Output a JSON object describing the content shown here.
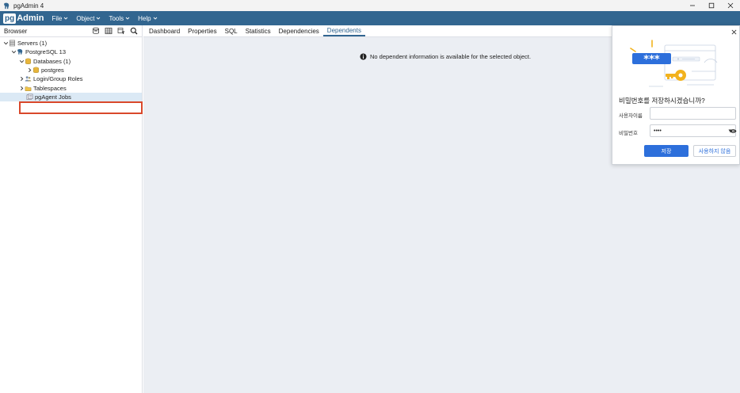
{
  "window": {
    "title": "pgAdmin 4"
  },
  "menubar": {
    "logo_pg": "pg",
    "logo_admin": "Admin",
    "items": [
      {
        "label": "File"
      },
      {
        "label": "Object"
      },
      {
        "label": "Tools"
      },
      {
        "label": "Help"
      }
    ]
  },
  "browser": {
    "label": "Browser",
    "tools": [
      "query-tool-icon",
      "view-data-icon",
      "filtered-rows-icon",
      "search-objects-icon"
    ],
    "tree": [
      {
        "label": "Servers (1)",
        "icon": "servers-icon",
        "expanded": true
      },
      {
        "label": "PostgreSQL 13",
        "icon": "server-icon",
        "expanded": true
      },
      {
        "label": "Databases (1)",
        "icon": "databases-icon",
        "expanded": true
      },
      {
        "label": "postgres",
        "icon": "database-icon",
        "expanded": false
      },
      {
        "label": "Login/Group Roles",
        "icon": "roles-icon",
        "expanded": false
      },
      {
        "label": "Tablespaces",
        "icon": "tablespaces-icon",
        "expanded": false
      },
      {
        "label": "pgAgent Jobs",
        "icon": "pgagent-jobs-icon",
        "selected": true
      }
    ]
  },
  "main": {
    "tabs": [
      {
        "label": "Dashboard"
      },
      {
        "label": "Properties"
      },
      {
        "label": "SQL"
      },
      {
        "label": "Statistics"
      },
      {
        "label": "Dependencies"
      },
      {
        "label": "Dependents",
        "active": true
      }
    ],
    "message": "No dependent information is available for the selected object."
  },
  "save_password_dialog": {
    "question": "비밀번호를 저장하시겠습니까?",
    "username_label": "사용자이름",
    "username_value": "",
    "password_label": "비밀번호",
    "password_value": "••••",
    "save_label": "저장",
    "never_label": "사용하지 않음",
    "illustration_mask": "***"
  },
  "colors": {
    "menubar": "#326690",
    "accent": "#2d6fdb",
    "highlight_box": "#d9482b",
    "main_bg": "#ebeef3"
  }
}
